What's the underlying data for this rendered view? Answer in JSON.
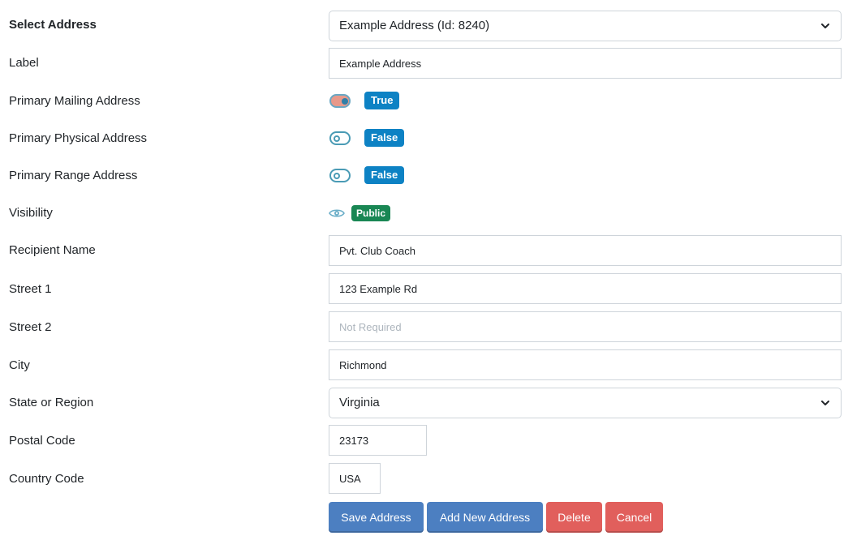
{
  "form": {
    "select_address": {
      "label": "Select Address",
      "value": "Example Address (Id: 8240)"
    },
    "label_field": {
      "label": "Label",
      "value": "Example Address"
    },
    "primary_mailing": {
      "label": "Primary Mailing Address",
      "state": "True"
    },
    "primary_physical": {
      "label": "Primary Physical Address",
      "state": "False"
    },
    "primary_range": {
      "label": "Primary Range Address",
      "state": "False"
    },
    "visibility": {
      "label": "Visibility",
      "state": "Public",
      "icon": "eye-icon"
    },
    "recipient_name": {
      "label": "Recipient Name",
      "value": "Pvt. Club Coach"
    },
    "street1": {
      "label": "Street 1",
      "value": "123 Example Rd"
    },
    "street2": {
      "label": "Street 2",
      "value": "",
      "placeholder": "Not Required"
    },
    "city": {
      "label": "City",
      "value": "Richmond"
    },
    "state": {
      "label": "State or Region",
      "value": "Virginia"
    },
    "postal_code": {
      "label": "Postal Code",
      "value": "23173"
    },
    "country_code": {
      "label": "Country Code",
      "value": "USA"
    }
  },
  "actions": {
    "save": "Save Address",
    "add_new": "Add New Address",
    "delete": "Delete",
    "cancel": "Cancel"
  },
  "colors": {
    "primary": "#4c7fc1",
    "danger": "#e15f5c",
    "badge_blue": "#0d82c4",
    "badge_green": "#198754",
    "toggle": "#4a9bb5"
  }
}
